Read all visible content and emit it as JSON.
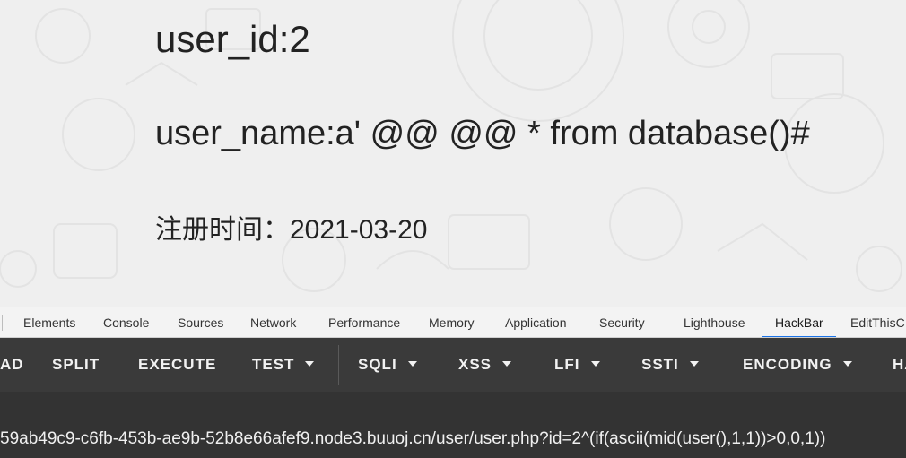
{
  "page": {
    "user_id_line": "user_id:2",
    "user_name_line": "user_name:a' @@ @@ * from database()#",
    "register_time_line": "注册时间：2021-03-20"
  },
  "devtools": {
    "tabs": [
      "Elements",
      "Console",
      "Sources",
      "Network",
      "Performance",
      "Memory",
      "Application",
      "Security",
      "Lighthouse",
      "HackBar",
      "EditThisC"
    ],
    "active_tab": "HackBar"
  },
  "hackbar": {
    "buttons": [
      "AD",
      "SPLIT",
      "EXECUTE",
      "TEST",
      "SQLI",
      "XSS",
      "LFI",
      "SSTI",
      "ENCODING",
      "HA"
    ],
    "url": "59ab49c9-c6fb-453b-ae9b-52b8e66afef9.node3.buuoj.cn/user/user.php?id=2^(if(ascii(mid(user(),1,1))>0,0,1))"
  },
  "colors": {
    "hackbar_bg": "#3a3a3a",
    "url_bg": "#333333",
    "active_tab_underline": "#1a73e8"
  }
}
